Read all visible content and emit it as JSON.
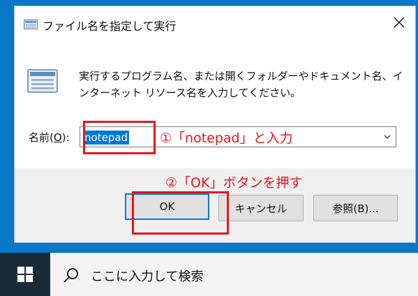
{
  "dialog": {
    "title": "ファイル名を指定して実行",
    "description": "実行するプログラム名、または開くフォルダーやドキュメント名、インターネット リソース名を入力してください。",
    "name_label_prefix": "名前(",
    "name_label_key": "O",
    "name_label_suffix": "):",
    "input_value": "notepad",
    "buttons": {
      "ok": "OK",
      "cancel": "キャンセル",
      "browse": "参照(B)..."
    }
  },
  "annotations": {
    "step1": "①「notepad」と入力",
    "step2": "②「OK」ボタンを押す",
    "color": "#e8141c"
  },
  "taskbar": {
    "search_placeholder": "ここに入力して検索"
  },
  "colors": {
    "accent": "#0078d7",
    "desktop": "#0a78c8",
    "taskbar": "#1b2a38"
  }
}
